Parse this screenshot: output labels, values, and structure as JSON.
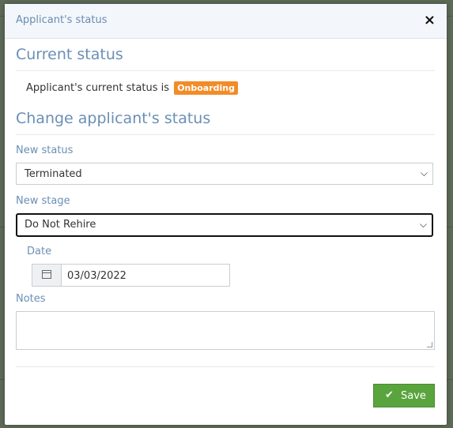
{
  "modal": {
    "title": "Applicant's status",
    "close": "×"
  },
  "current": {
    "heading": "Current status",
    "text": "Applicant's current status is",
    "badge": "Onboarding",
    "badge_color": "#f28c28"
  },
  "change": {
    "heading": "Change applicant's status",
    "new_status_label": "New status",
    "new_status_value": "Terminated",
    "new_stage_label": "New stage",
    "new_stage_value": "Do Not Rehire",
    "date_label": "Date",
    "date_value": "03/03/2022",
    "notes_label": "Notes",
    "notes_value": ""
  },
  "actions": {
    "save_label": "Save",
    "save_color": "#5aa43d"
  },
  "icons": {
    "close": "close-icon",
    "calendar": "calendar-icon",
    "check": "check-icon",
    "chevron": "chevron-down-icon"
  }
}
